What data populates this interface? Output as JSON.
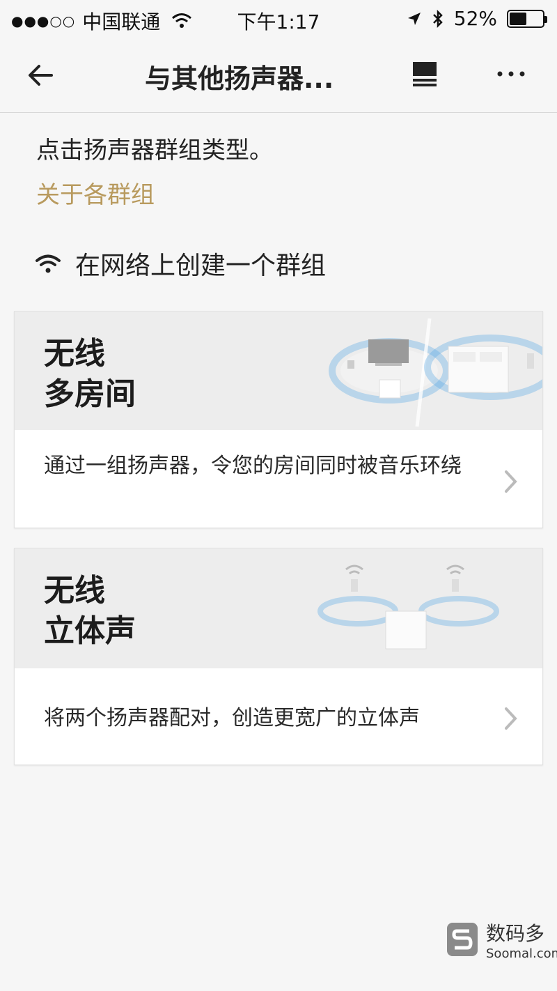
{
  "status_bar": {
    "signal": "●●●○○",
    "carrier": "中国联通",
    "time": "下午1:17",
    "battery": "52%",
    "battery_level": 0.52
  },
  "nav": {
    "title": "与其他扬声器..."
  },
  "intro": {
    "text": "点击扬声器群组类型。",
    "link": "关于各群组"
  },
  "section": {
    "title": "在网络上创建一个群组"
  },
  "cards": [
    {
      "title_line1": "无线",
      "title_line2": "多房间",
      "description": "通过一组扬声器，令您的房间同时被音乐环绕"
    },
    {
      "title_line1": "无线",
      "title_line2": "立体声",
      "description": "将两个扬声器配对，创造更宽广的立体声"
    }
  ],
  "watermark": {
    "name": "数码多",
    "domain": "Soomal.com"
  },
  "colors": {
    "accent_link": "#b89a5e",
    "background": "#f6f6f6",
    "illustration_blue": "#5aa9e6"
  }
}
